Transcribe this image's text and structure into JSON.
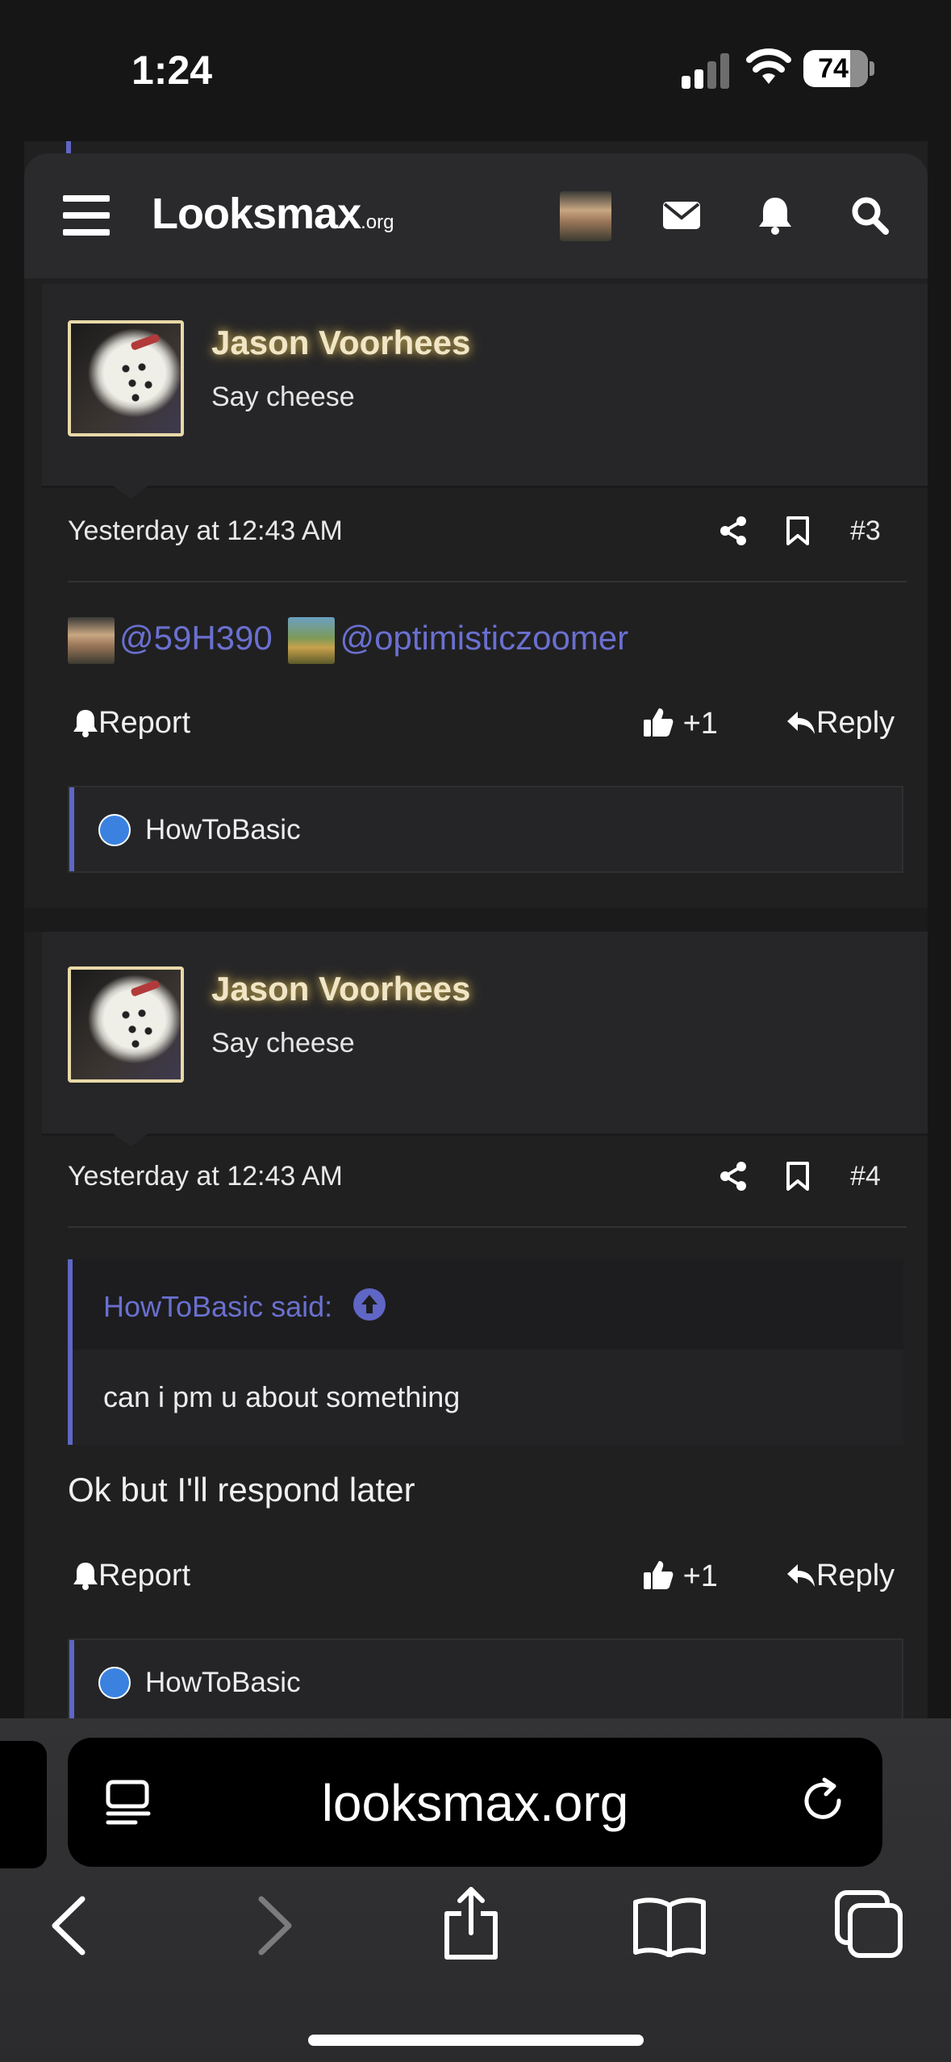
{
  "status_bar": {
    "time": "1:24",
    "battery": "74"
  },
  "header": {
    "logo_main": "Looksmax",
    "logo_tld": ".org",
    "icons": [
      "menu-icon",
      "user-avatar",
      "envelope-icon",
      "bell-icon",
      "search-icon"
    ]
  },
  "posts": [
    {
      "username": "Jason Voorhees",
      "user_title": "Say cheese",
      "date": "Yesterday at 12:43 AM",
      "number": "#3",
      "mentions": [
        "@59H390",
        "@optimisticzoomer"
      ],
      "report_label": "Report",
      "like_count": "+1",
      "reply_label": "Reply",
      "reactions_by": "HowToBasic"
    },
    {
      "username": "Jason Voorhees",
      "user_title": "Say cheese",
      "date": "Yesterday at 12:43 AM",
      "number": "#4",
      "quote_author": "HowToBasic said:",
      "quote_text": "can i pm u about something",
      "body": "Ok but I'll respond later",
      "report_label": "Report",
      "like_count": "+1",
      "reply_label": "Reply",
      "reactions_by": "HowToBasic"
    }
  ],
  "browser": {
    "url": "looksmax.org",
    "toolbar_icons": [
      "back-icon",
      "forward-icon",
      "share-icon",
      "bookmarks-icon",
      "tabs-icon"
    ]
  },
  "colors": {
    "accent": "#5f66c5",
    "link": "#6a70cf",
    "username_glow": "#b79f55",
    "like_blue": "#3b82e0"
  }
}
